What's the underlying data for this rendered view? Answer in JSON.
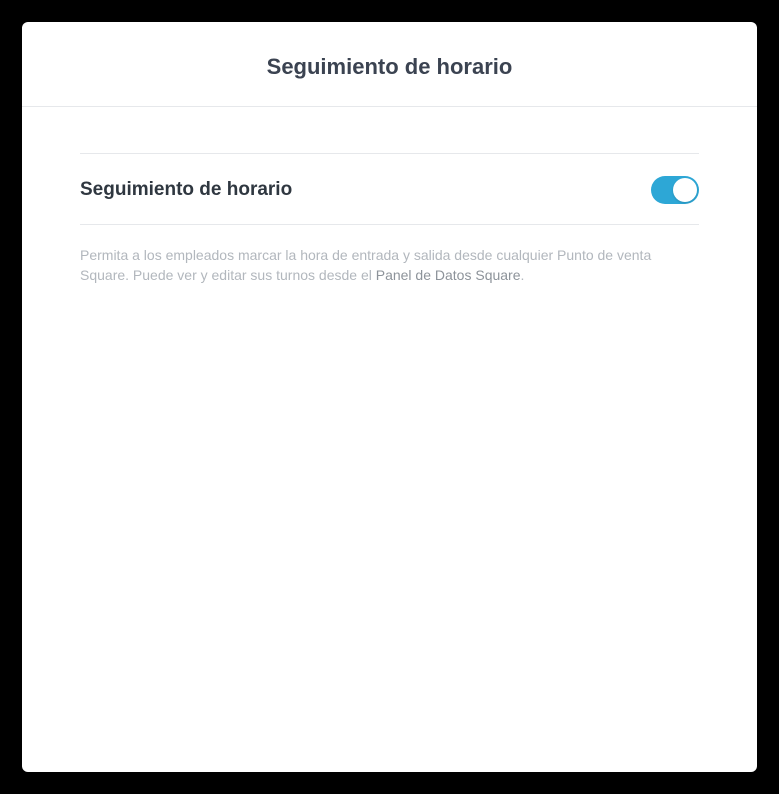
{
  "header": {
    "title": "Seguimiento de horario"
  },
  "setting": {
    "label": "Seguimiento de horario",
    "enabled": true
  },
  "description": {
    "text_before": "Permita a los empleados marcar la hora de entrada y salida desde cualquier Punto de venta Square. Puede ver y editar sus turnos desde el ",
    "link_text": "Panel de Datos Square",
    "text_after": "."
  }
}
